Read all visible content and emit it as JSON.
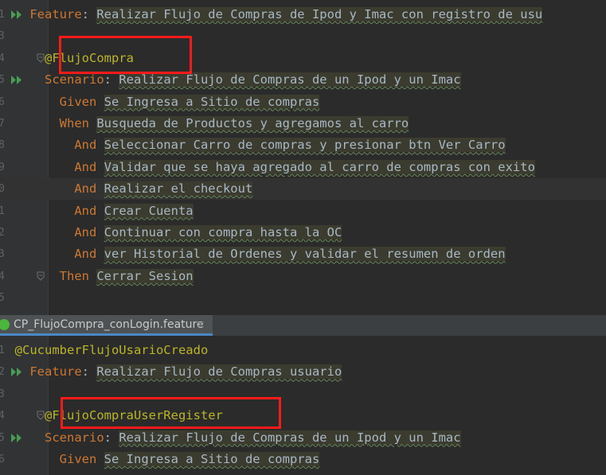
{
  "editor_top": {
    "lines": [
      {
        "ln": "1",
        "run": true,
        "fold": false,
        "parts": [
          {
            "s": "kw",
            "t": "    Feature"
          },
          {
            "s": "txt",
            "t": ": "
          },
          {
            "s": "hl",
            "t": "Realizar Flujo de Compras de Ipod y Imac con registro de usu"
          }
        ]
      },
      {
        "ln": "3",
        "run": false,
        "fold": false,
        "parts": []
      },
      {
        "ln": "4",
        "run": false,
        "fold": true,
        "parts": [
          {
            "s": "tag",
            "t": "      @FlujoCompra"
          }
        ]
      },
      {
        "ln": "5",
        "run": true,
        "fold": false,
        "parts": [
          {
            "s": "kw",
            "t": "      Scenario"
          },
          {
            "s": "txt",
            "t": ": "
          },
          {
            "s": "hl",
            "t": "Realizar Flujo de Compras de un Ipod y un Imac"
          }
        ]
      },
      {
        "ln": "6",
        "run": false,
        "fold": false,
        "parts": [
          {
            "s": "kw",
            "t": "        Given "
          },
          {
            "s": "hl",
            "t": "Se Ingresa a Sitio de compras"
          }
        ]
      },
      {
        "ln": "7",
        "run": false,
        "fold": false,
        "parts": [
          {
            "s": "kw",
            "t": "        When "
          },
          {
            "s": "hl",
            "t": "Busqueda de Productos y agregamos al carro"
          }
        ]
      },
      {
        "ln": "8",
        "run": false,
        "fold": false,
        "parts": [
          {
            "s": "kw",
            "t": "          And "
          },
          {
            "s": "hl",
            "t": "Seleccionar Carro de compras y presionar btn Ver Carro"
          }
        ]
      },
      {
        "ln": "9",
        "run": false,
        "fold": false,
        "parts": [
          {
            "s": "kw",
            "t": "          And "
          },
          {
            "s": "hl",
            "t": "Validar que se haya agregado al carro de compras con exito"
          }
        ]
      },
      {
        "ln": "0",
        "run": false,
        "fold": false,
        "current": true,
        "parts": [
          {
            "s": "kw",
            "t": "          And "
          },
          {
            "s": "hl",
            "t": "Realizar el checkout"
          }
        ]
      },
      {
        "ln": "1",
        "run": false,
        "fold": false,
        "parts": [
          {
            "s": "kw",
            "t": "          And "
          },
          {
            "s": "hl",
            "t": "Crear Cuenta"
          }
        ]
      },
      {
        "ln": "2",
        "run": false,
        "fold": false,
        "parts": [
          {
            "s": "kw",
            "t": "          And "
          },
          {
            "s": "hl",
            "t": "Continuar con compra hasta la OC"
          }
        ]
      },
      {
        "ln": "3",
        "run": false,
        "fold": false,
        "parts": [
          {
            "s": "kw",
            "t": "          And "
          },
          {
            "s": "hl",
            "t": "ver Historial de Ordenes y validar el resumen de orden"
          }
        ]
      },
      {
        "ln": "4",
        "run": false,
        "fold": true,
        "parts": [
          {
            "s": "kw",
            "t": "        Then "
          },
          {
            "s": "hl",
            "t": "Cerrar Sesion"
          }
        ]
      },
      {
        "ln": "5",
        "run": false,
        "fold": false,
        "parts": []
      }
    ]
  },
  "tab": {
    "label": "CP_FlujoCompra_conLogin.feature",
    "close": "×"
  },
  "editor_bottom": {
    "lines": [
      {
        "ln": "1",
        "run": false,
        "fold": false,
        "parts": [
          {
            "s": "tag",
            "t": "  @CucumberFlujoUsarioCreado"
          }
        ]
      },
      {
        "ln": "2",
        "run": true,
        "fold": false,
        "parts": [
          {
            "s": "kw",
            "t": "    Feature"
          },
          {
            "s": "txt",
            "t": ": "
          },
          {
            "s": "hl",
            "t": "Realizar Flujo de Compras usuario"
          }
        ]
      },
      {
        "ln": "3",
        "run": false,
        "fold": false,
        "parts": []
      },
      {
        "ln": "4",
        "run": false,
        "fold": true,
        "parts": [
          {
            "s": "tag",
            "t": "      @FlujoCompraUserRegister"
          }
        ]
      },
      {
        "ln": "5",
        "run": true,
        "fold": false,
        "parts": [
          {
            "s": "kw",
            "t": "      Scenario"
          },
          {
            "s": "txt",
            "t": ": "
          },
          {
            "s": "hl",
            "t": "Realizar Flujo de Compras de un Ipod y un Imac"
          }
        ]
      },
      {
        "ln": "6",
        "run": false,
        "fold": false,
        "parts": [
          {
            "s": "kw",
            "t": "        Given "
          },
          {
            "s": "hl",
            "t": "Se Ingresa a Sitio de compras"
          }
        ]
      }
    ]
  },
  "colors": {
    "keyword": "#cc7832",
    "tag": "#bbb529",
    "text": "#a9b7c6",
    "highlight": "#ff1a1a",
    "tab_accent": "#4a88c7"
  }
}
